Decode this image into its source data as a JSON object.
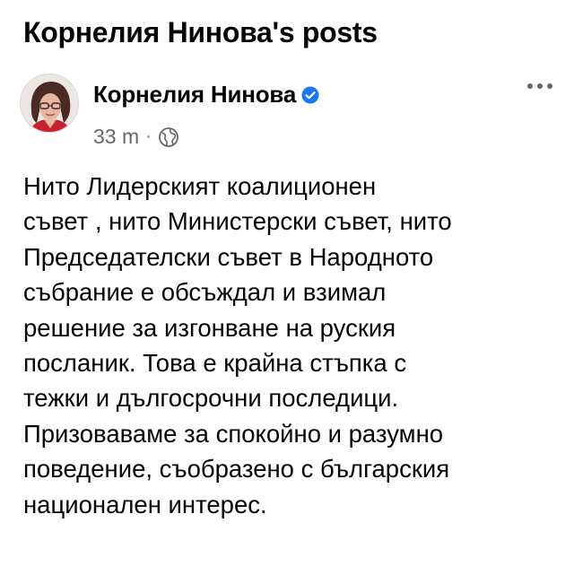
{
  "page": {
    "title": "Корнелия Нинова's posts"
  },
  "post": {
    "author": "Корнелия Нинова",
    "verified": true,
    "time": "33 m",
    "separator": "·",
    "audience_icon": "globe-icon",
    "menu_icon": "more-horizontal-icon",
    "text_lines": [
      "Нито Лидерският коалиционен",
      "съвет , нито Министерски съвет, нито",
      "Председателски съвет в Народното",
      "събрание е обсъждал и взимал",
      "решение за изгонване на руския",
      "посланик. Това е крайна стъпка с",
      "тежки и дългосрочни последици.",
      "Призоваваме за спокойно и разумно",
      "поведение, съобразено с българския",
      "национален интерес."
    ]
  },
  "colors": {
    "text_primary": "#050505",
    "text_secondary": "#65676b",
    "verified_blue": "#1877f2",
    "background": "#ffffff"
  }
}
